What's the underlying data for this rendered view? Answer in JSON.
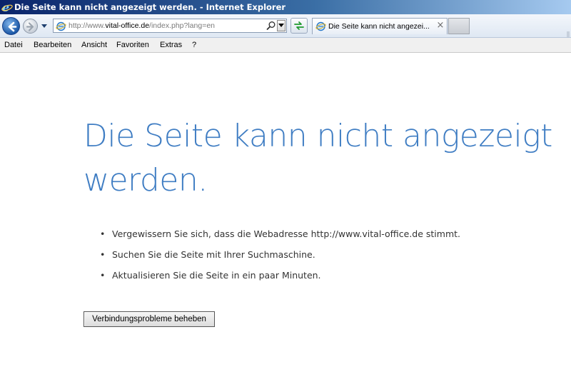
{
  "window": {
    "title": "Die Seite kann nicht angezeigt werden. - Internet Explorer"
  },
  "navbar": {
    "url_prefix": "http://www.",
    "url_domain": "vital-office.de",
    "url_suffix": "/index.php?lang=en"
  },
  "tab": {
    "title": "Die Seite kann nicht angezei...",
    "close": "×"
  },
  "menu": [
    "Datei",
    "Bearbeiten",
    "Ansicht",
    "Favoriten",
    "Extras",
    "?"
  ],
  "content": {
    "heading": "Die Seite kann nicht angezeigt werden.",
    "bullet": "•",
    "suggestions": [
      "Vergewissern Sie sich, dass die Webadresse http://www.vital-office.de stimmt.",
      "Suchen Sie die Seite mit Ihrer Suchmaschine.",
      "Aktualisieren Sie die Seite in ein paar Minuten."
    ],
    "fix_button_label": "Verbindungsprobleme beheben"
  },
  "colors": {
    "heading": "#3f7dc3",
    "titlebar": "#0a246a"
  }
}
